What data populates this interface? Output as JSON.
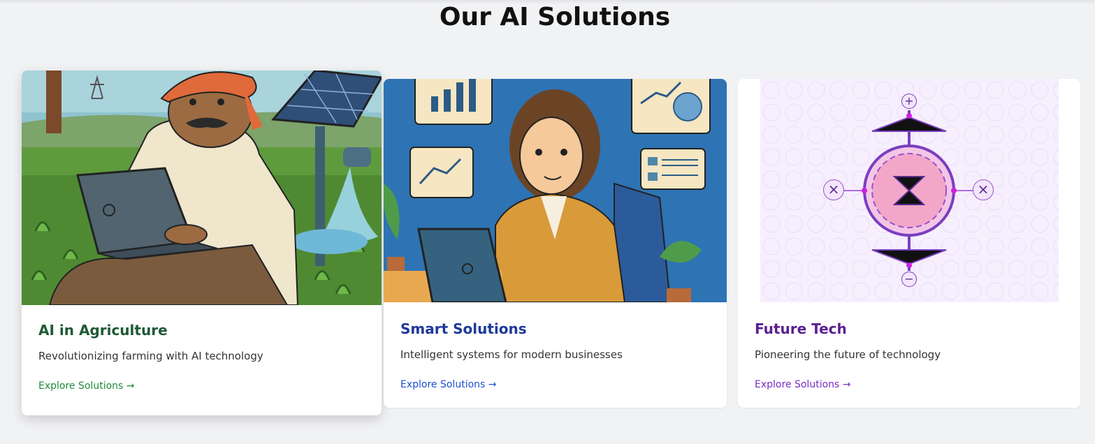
{
  "page": {
    "title": "Our AI Solutions"
  },
  "cards": [
    {
      "title": "AI in Agriculture",
      "description": "Revolutionizing farming with AI technology",
      "link": "Explore Solutions →",
      "title_color": "#1f5a35",
      "link_color": "#1e8a3c"
    },
    {
      "title": "Smart Solutions",
      "description": "Intelligent systems for modern businesses",
      "link": "Explore Solutions →",
      "title_color": "#1e3a9a",
      "link_color": "#1d4fd0"
    },
    {
      "title": "Future Tech",
      "description": "Pioneering the future of technology",
      "link": "Explore Solutions →",
      "title_color": "#5b1f92",
      "link_color": "#7a2bc4"
    }
  ],
  "icons": {
    "plus": "+",
    "minus": "−",
    "close": "×"
  }
}
